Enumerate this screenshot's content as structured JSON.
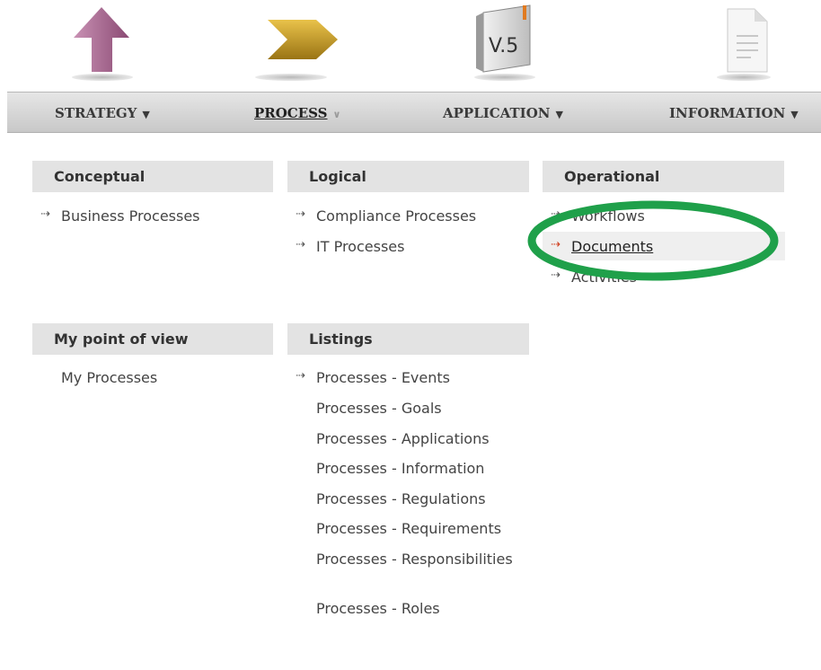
{
  "top_icons": [
    {
      "name": "strategy-arrow-icon"
    },
    {
      "name": "process-chevron-icon"
    },
    {
      "name": "application-box-icon",
      "label": "V.5"
    },
    {
      "name": "information-document-icon"
    }
  ],
  "nav": {
    "strategy": "STRATEGY",
    "process": "PROCESS",
    "application": "APPLICATION",
    "information": "INFORMATION"
  },
  "sections": {
    "conceptual": {
      "title": "Conceptual",
      "items": [
        "Business Processes"
      ]
    },
    "logical": {
      "title": "Logical",
      "items": [
        "Compliance Processes",
        "IT Processes"
      ]
    },
    "operational": {
      "title": "Operational",
      "items": [
        "Workflows",
        "Documents",
        "Activities"
      ]
    },
    "pov": {
      "title": "My point of view",
      "items": [
        "My Processes"
      ]
    },
    "listings": {
      "title": "Listings",
      "items": [
        "Processes - Events",
        "Processes - Goals",
        "Processes - Applications",
        "Processes - Information",
        "Processes - Regulations",
        "Processes - Requirements",
        "Processes - Responsibilities",
        "Processes - Roles"
      ]
    }
  },
  "colors": {
    "highlight_circle": "#1fa04a",
    "nav_bg": "#d4d4d4",
    "section_bg": "#e3e3e3"
  }
}
